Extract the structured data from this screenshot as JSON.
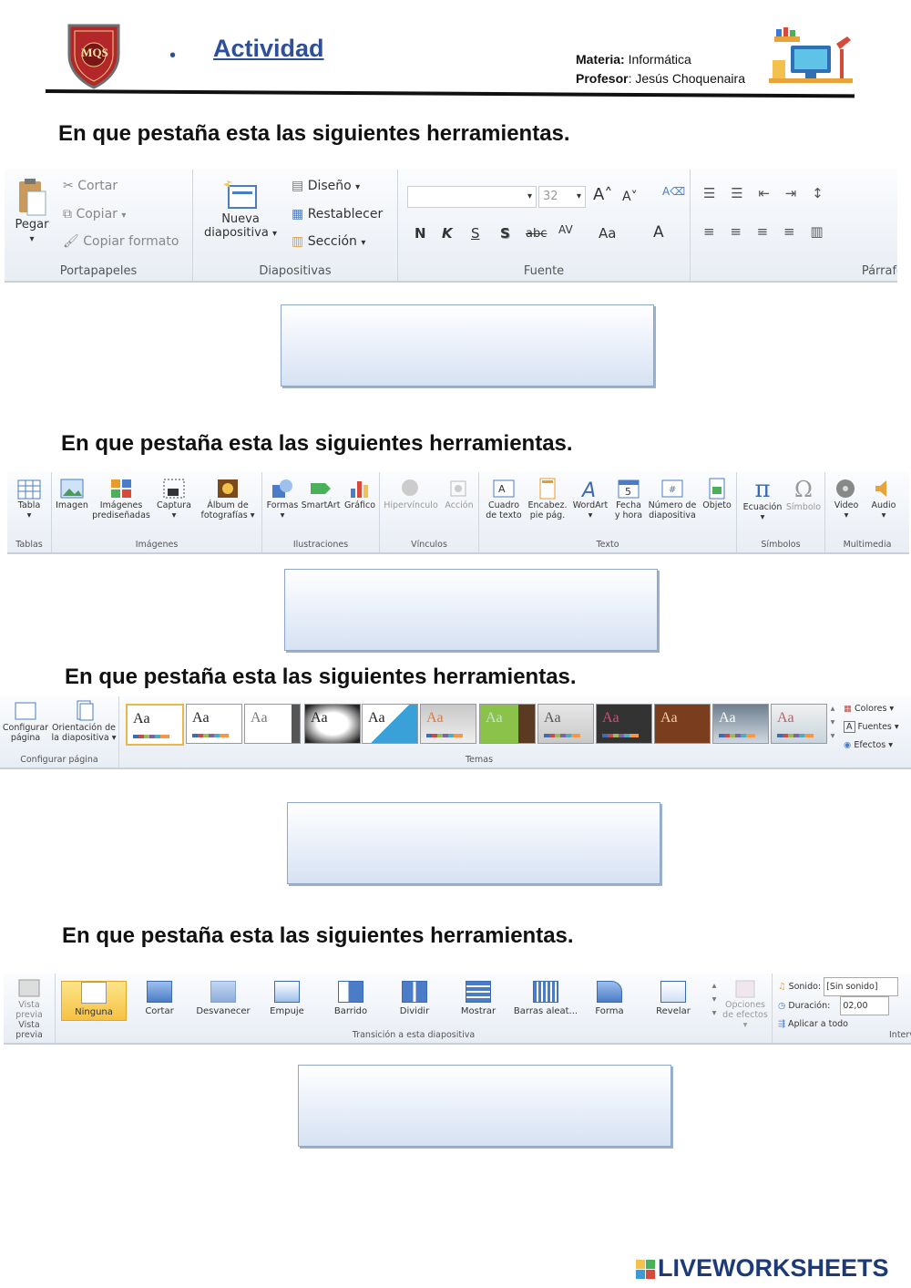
{
  "header": {
    "title": "Actividad",
    "materia_label": "Materia:",
    "materia_value": " Informática",
    "profesor_label": "Profesor",
    "profesor_value": ": Jesús Choquenaira",
    "logo_text": "MQS",
    "colors": {
      "title": "#2e4f9a",
      "shield": "#b3262a"
    }
  },
  "questions": [
    "En que pestaña esta las siguientes herramientas.",
    "En que pestaña esta las siguientes herramientas.",
    "En que pestaña esta las siguientes herramientas.",
    "En que pestaña esta las siguientes herramientas."
  ],
  "ribbon1": {
    "pegar": "Pegar",
    "cortar": "Cortar",
    "copiar": "Copiar",
    "copiar_formato": "Copiar formato",
    "portapapeles": "Portapapeles",
    "nueva": "Nueva",
    "diapositiva": "diapositiva",
    "diseno": "Diseño",
    "restablecer": "Restablecer",
    "seccion": "Sección",
    "diapositivas": "Diapositivas",
    "font_size": "32",
    "fuente": "Fuente",
    "parrafo": "Párrafo",
    "fmt_n": "N",
    "fmt_k": "K",
    "fmt_s": "S",
    "fmt_s2": "S",
    "fmt_abc": "abc",
    "fmt_av": "AV",
    "fmt_aa": "Aa",
    "fmt_a": "A"
  },
  "ribbon2": {
    "tabla": "Tabla",
    "imagen": "Imagen",
    "imagenes": "Imágenes",
    "predisenadas": "prediseñadas",
    "captura": "Captura",
    "album": "Álbum de",
    "fotografias": "fotografías",
    "formas": "Formas",
    "smartart": "SmartArt",
    "grafico": "Gráfico",
    "hipervinculo": "Hipervínculo",
    "accion": "Acción",
    "cuadro": "Cuadro",
    "de_texto": "de texto",
    "encabez": "Encabez.",
    "pie_pag": "pie pág.",
    "wordart": "WordArt",
    "fecha": "Fecha",
    "y_hora": "y hora",
    "numero_de": "Número de",
    "diapositiva": "diapositiva",
    "objeto": "Objeto",
    "ecuacion": "Ecuación",
    "simbolo": "Símbolo",
    "video": "Video",
    "audio": "Audio",
    "g_tablas": "Tablas",
    "g_imagenes": "Imágenes",
    "g_ilustraciones": "Ilustraciones",
    "g_vinculos": "Vínculos",
    "g_texto": "Texto",
    "g_simbolos": "Símbolos",
    "g_multimedia": "Multimedia",
    "fecha_num": "5"
  },
  "ribbon3": {
    "configurar": "Configurar",
    "pagina": "página",
    "orientacion": "Orientación de",
    "la_diapositiva": "la diapositiva",
    "g_configurar": "Configurar página",
    "g_temas": "Temas",
    "colores": "Colores",
    "fuentes": "Fuentes",
    "efectos": "Efectos",
    "theme_label": "Aa"
  },
  "ribbon4": {
    "vista_previa_btn": "Vista",
    "previa": "previa",
    "ninguna": "Ninguna",
    "cortar": "Cortar",
    "desvanecer": "Desvanecer",
    "empuje": "Empuje",
    "barrido": "Barrido",
    "dividir": "Dividir",
    "mostrar": "Mostrar",
    "barras": "Barras aleat...",
    "forma": "Forma",
    "revelar": "Revelar",
    "opciones": "Opciones",
    "de_efectos": "de efectos",
    "sonido_label": "Sonido:",
    "sonido_value": "[Sin sonido]",
    "duracion_label": "Duración:",
    "duracion_value": "02,00",
    "aplicar": "Aplicar a todo",
    "g_vista": "Vista previa",
    "g_transicion": "Transición a esta diapositiva",
    "g_interv": "Interv"
  },
  "footer": {
    "brand": "LIVEWORKSHEETS"
  }
}
